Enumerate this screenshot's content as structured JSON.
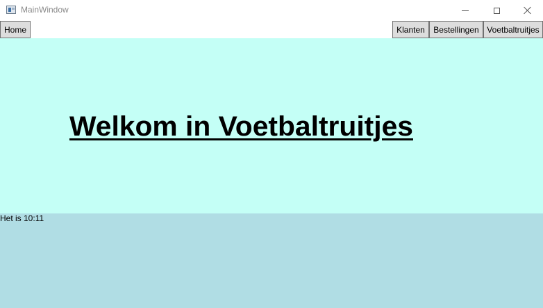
{
  "window": {
    "title": "MainWindow",
    "icon": "app-window-icon"
  },
  "nav": {
    "home_label": "Home",
    "klanten_label": "Klanten",
    "bestellingen_label": "Bestellingen",
    "voetbaltruitjes_label": "Voetbaltruitjes"
  },
  "main": {
    "welcome_text": "Welkom in Voetbaltruitjes"
  },
  "footer": {
    "time_text": "Het is 10:11"
  },
  "colors": {
    "hero_background": "#c4fff6",
    "footer_background": "#b0dde4",
    "button_background": "#dddddd"
  }
}
